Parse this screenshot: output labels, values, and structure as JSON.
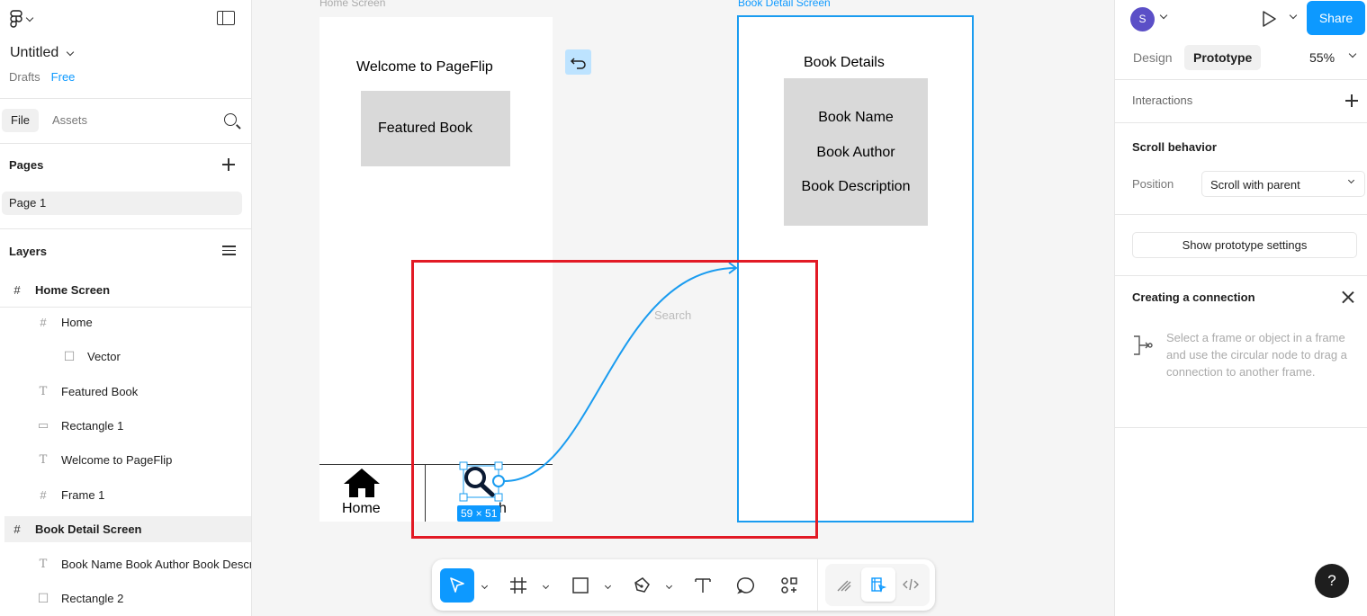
{
  "app": {
    "file_name": "Untitled",
    "location": "Drafts",
    "plan_badge": "Free"
  },
  "left_panel": {
    "tabs": [
      "File",
      "Assets"
    ],
    "pages_title": "Pages",
    "pages": [
      "Page 1"
    ],
    "layers_title": "Layers",
    "layers": [
      {
        "label": "Home Screen",
        "kind": "frame-icon"
      },
      {
        "label": "Home",
        "kind": "frame-icon"
      },
      {
        "label": "Vector",
        "kind": "vector-icon"
      },
      {
        "label": "Featured Book",
        "kind": "text-icon"
      },
      {
        "label": "Rectangle 1",
        "kind": "rectangle-icon"
      },
      {
        "label": "Welcome to PageFlip",
        "kind": "text-icon"
      },
      {
        "label": "Frame 1",
        "kind": "frame-icon"
      },
      {
        "label": "Book Detail Screen",
        "kind": "frame-icon"
      },
      {
        "label": "Book Name Book Author Book Description",
        "kind": "text-icon"
      },
      {
        "label": "Rectangle 2",
        "kind": "vector-icon"
      }
    ]
  },
  "canvas": {
    "home_frame_label": "Home Screen",
    "detail_frame_label": "Book Detail Screen",
    "welcome_text": "Welcome to PageFlip",
    "featured_text": "Featured Book",
    "home_nav_label": "Home",
    "search_nav_tail": "h",
    "search_canvas_label": "Search",
    "selection_size": "59 × 51",
    "detail_title": "Book Details",
    "detail_lines": [
      "Book Name",
      "Book Author",
      "Book Description"
    ]
  },
  "right_panel": {
    "avatar_initial": "S",
    "share_label": "Share",
    "tabs": [
      "Design",
      "Prototype"
    ],
    "zoom": "55%",
    "interactions_title": "Interactions",
    "scroll_behavior_title": "Scroll behavior",
    "position_label": "Position",
    "position_value": "Scroll with parent",
    "show_settings_label": "Show prototype settings",
    "creating_connection_title": "Creating a connection",
    "connection_help": "Select a frame or object in a frame and use the circular node to drag a connection to another frame.",
    "help_label": "?"
  },
  "colors": {
    "accent": "#0d99ff",
    "highlight": "#e21a25",
    "connector": "#1a9cf0"
  }
}
